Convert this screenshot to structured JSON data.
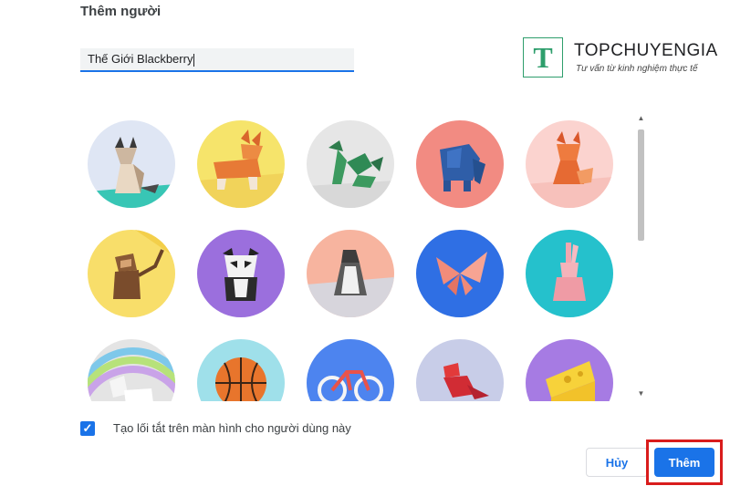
{
  "dialog": {
    "title": "Thêm người",
    "name_value": "Thế Giới Blackberry",
    "shortcut_label": "Tạo lối tắt trên màn hình cho người dùng này",
    "shortcut_checked": true,
    "cancel_label": "Hủy",
    "add_label": "Thêm"
  },
  "watermark": {
    "letter": "T",
    "name": "TOPCHUYENGIA",
    "tagline": "Tư vấn từ kinh nghiệm thực tế"
  },
  "avatars": [
    {
      "name": "cat",
      "bg": "#dfe6f4"
    },
    {
      "name": "corgi",
      "bg": "#f6e46b"
    },
    {
      "name": "dragon",
      "bg": "#e6e6e6"
    },
    {
      "name": "elephant",
      "bg": "#f28b82"
    },
    {
      "name": "fox",
      "bg": "#fbd3cf"
    },
    {
      "name": "monkey",
      "bg": "#f8de6a"
    },
    {
      "name": "panda",
      "bg": "#9b6fdd"
    },
    {
      "name": "penguin",
      "bg": "#f7b49f"
    },
    {
      "name": "butterfly",
      "bg": "#2f6fe4"
    },
    {
      "name": "rabbit",
      "bg": "#25c1cc"
    },
    {
      "name": "unicorn",
      "bg": "#e4e4e4"
    },
    {
      "name": "basketball",
      "bg": "#9fe0ea"
    },
    {
      "name": "bicycle",
      "bg": "#4d84ef"
    },
    {
      "name": "bird",
      "bg": "#c8cde8"
    },
    {
      "name": "cheese",
      "bg": "#a67be3"
    }
  ],
  "colors": {
    "accent": "#1a73e8",
    "highlight": "#d91c1c",
    "brand_green": "#2e9e6c"
  }
}
